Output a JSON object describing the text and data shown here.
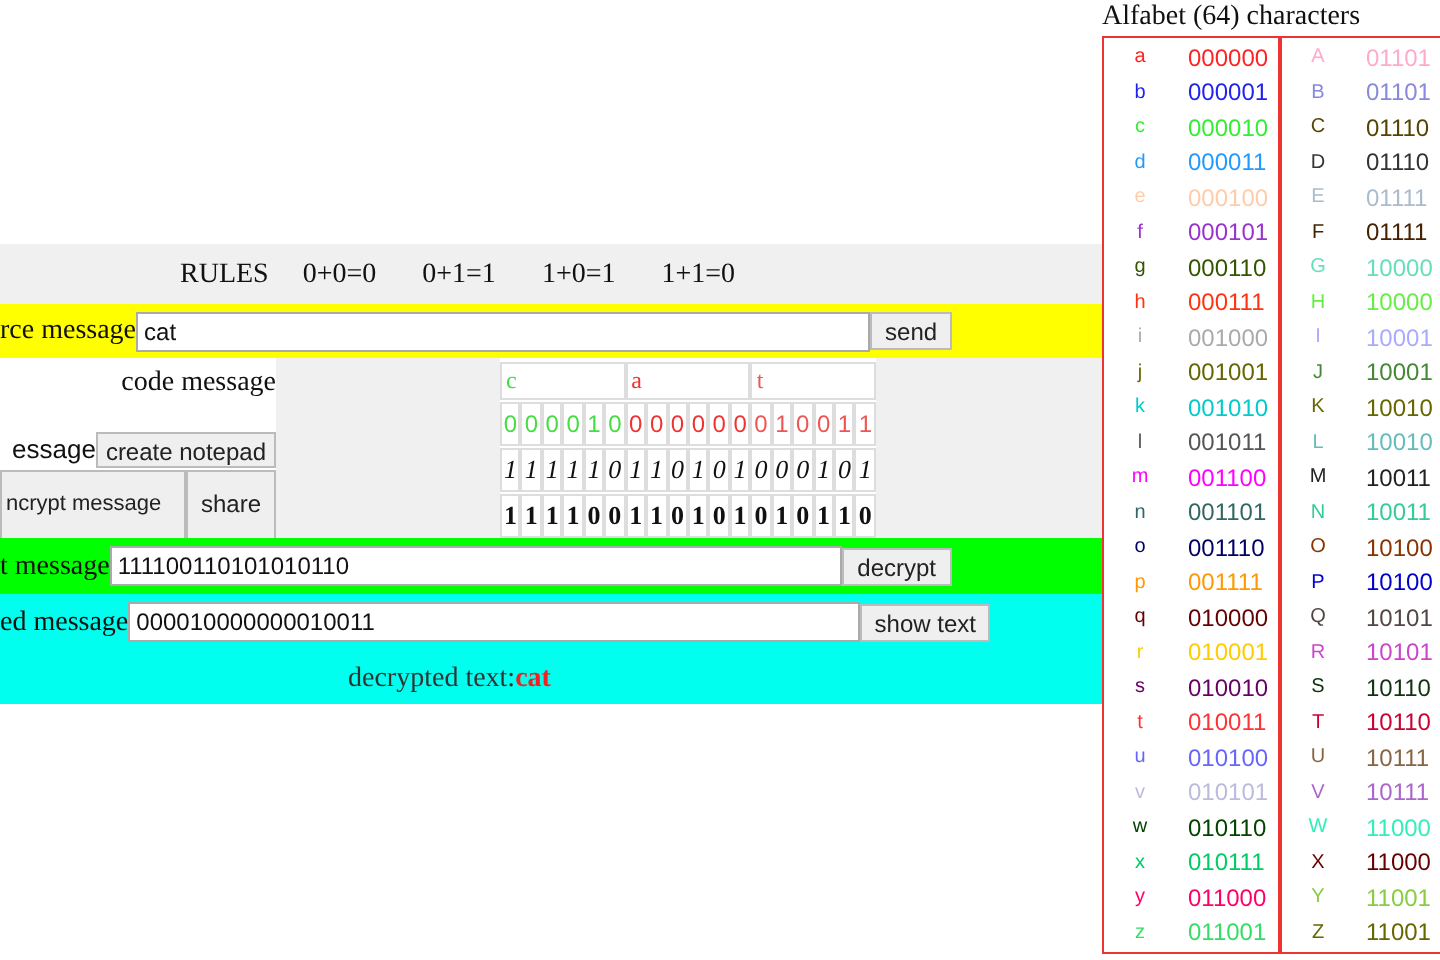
{
  "rules": {
    "title": "RULES",
    "items": [
      "0+0=0",
      "0+1=1",
      "1+0=1",
      "1+1=0"
    ]
  },
  "source": {
    "label": "rce message",
    "value": "cat",
    "button": "send"
  },
  "code": {
    "label": "code message",
    "notepad_label": "essage",
    "notepad_button": "create notepad",
    "encrypt_button": "ncrypt message",
    "share_button": "share",
    "letters": [
      {
        "char": "c",
        "color": "#44dd44",
        "bits": [
          "0",
          "0",
          "0",
          "0",
          "1",
          "0"
        ]
      },
      {
        "char": "a",
        "color": "#ee3333",
        "bits": [
          "0",
          "0",
          "0",
          "0",
          "0",
          "0"
        ]
      },
      {
        "char": "t",
        "color": "#ee5555",
        "bits": [
          "0",
          "1",
          "0",
          "0",
          "1",
          "1"
        ]
      }
    ],
    "key_row": [
      "1",
      "1",
      "1",
      "1",
      "1",
      "0",
      "1",
      "1",
      "0",
      "1",
      "0",
      "1",
      "0",
      "0",
      "0",
      "1",
      "0",
      "1"
    ],
    "result_row": [
      "1",
      "1",
      "1",
      "1",
      "0",
      "0",
      "1",
      "1",
      "0",
      "1",
      "0",
      "1",
      "0",
      "1",
      "0",
      "1",
      "1",
      "0"
    ]
  },
  "encrypted": {
    "label": "t message",
    "value": "111100110101010110",
    "button": "decrypt"
  },
  "decrypted": {
    "label": "ed message",
    "value": "000010000000010011",
    "button": "show text",
    "result_label": "decrypted text:",
    "result_value": "cat"
  },
  "alphabet": {
    "title": "Alfabet (64) characters",
    "lower": [
      {
        "char": "a",
        "code": "000000",
        "color": "#ff2222"
      },
      {
        "char": "b",
        "code": "000001",
        "color": "#2222ee"
      },
      {
        "char": "c",
        "code": "000010",
        "color": "#33ee33"
      },
      {
        "char": "d",
        "code": "000011",
        "color": "#2299ff"
      },
      {
        "char": "e",
        "code": "000100",
        "color": "#ffccaa"
      },
      {
        "char": "f",
        "code": "000101",
        "color": "#9933cc"
      },
      {
        "char": "g",
        "code": "000110",
        "color": "#335500"
      },
      {
        "char": "h",
        "code": "000111",
        "color": "#ff3311"
      },
      {
        "char": "i",
        "code": "001000",
        "color": "#aaaaaa"
      },
      {
        "char": "j",
        "code": "001001",
        "color": "#666600"
      },
      {
        "char": "k",
        "code": "001010",
        "color": "#00cccc"
      },
      {
        "char": "l",
        "code": "001011",
        "color": "#555555"
      },
      {
        "char": "m",
        "code": "001100",
        "color": "#ff00ff"
      },
      {
        "char": "n",
        "code": "001101",
        "color": "#336666"
      },
      {
        "char": "o",
        "code": "001110",
        "color": "#000066"
      },
      {
        "char": "p",
        "code": "001111",
        "color": "#ff9900"
      },
      {
        "char": "q",
        "code": "010000",
        "color": "#660000"
      },
      {
        "char": "r",
        "code": "010001",
        "color": "#ffcc00"
      },
      {
        "char": "s",
        "code": "010010",
        "color": "#660066"
      },
      {
        "char": "t",
        "code": "010011",
        "color": "#ff3333"
      },
      {
        "char": "u",
        "code": "010100",
        "color": "#6666ff"
      },
      {
        "char": "v",
        "code": "010101",
        "color": "#bbbbdd"
      },
      {
        "char": "w",
        "code": "010110",
        "color": "#004400"
      },
      {
        "char": "x",
        "code": "010111",
        "color": "#00cc66"
      },
      {
        "char": "y",
        "code": "011000",
        "color": "#ff0066"
      },
      {
        "char": "z",
        "code": "011001",
        "color": "#33dd66"
      }
    ],
    "upper": [
      {
        "char": "A",
        "code": "01101",
        "color": "#ffaacc"
      },
      {
        "char": "B",
        "code": "01101",
        "color": "#8888dd"
      },
      {
        "char": "C",
        "code": "01110",
        "color": "#554400"
      },
      {
        "char": "D",
        "code": "01110",
        "color": "#333333"
      },
      {
        "char": "E",
        "code": "01111",
        "color": "#aabbcc"
      },
      {
        "char": "F",
        "code": "01111",
        "color": "#442200"
      },
      {
        "char": "G",
        "code": "10000",
        "color": "#66ddbb"
      },
      {
        "char": "H",
        "code": "10000",
        "color": "#66ee44"
      },
      {
        "char": "I",
        "code": "10001",
        "color": "#aaaaff"
      },
      {
        "char": "J",
        "code": "10001",
        "color": "#448833"
      },
      {
        "char": "K",
        "code": "10010",
        "color": "#666600"
      },
      {
        "char": "L",
        "code": "10010",
        "color": "#66bbbb"
      },
      {
        "char": "M",
        "code": "10011",
        "color": "#222222"
      },
      {
        "char": "N",
        "code": "10011",
        "color": "#33cc99"
      },
      {
        "char": "O",
        "code": "10100",
        "color": "#883300"
      },
      {
        "char": "P",
        "code": "10100",
        "color": "#0000cc"
      },
      {
        "char": "Q",
        "code": "10101",
        "color": "#554444"
      },
      {
        "char": "R",
        "code": "10101",
        "color": "#cc44cc"
      },
      {
        "char": "S",
        "code": "10110",
        "color": "#113311"
      },
      {
        "char": "T",
        "code": "10110",
        "color": "#cc0033"
      },
      {
        "char": "U",
        "code": "10111",
        "color": "#886644"
      },
      {
        "char": "V",
        "code": "10111",
        "color": "#aa66cc"
      },
      {
        "char": "W",
        "code": "11000",
        "color": "#33eebb"
      },
      {
        "char": "X",
        "code": "11000",
        "color": "#660000"
      },
      {
        "char": "Y",
        "code": "11001",
        "color": "#88cc44"
      },
      {
        "char": "Z",
        "code": "11001",
        "color": "#666600"
      }
    ]
  }
}
